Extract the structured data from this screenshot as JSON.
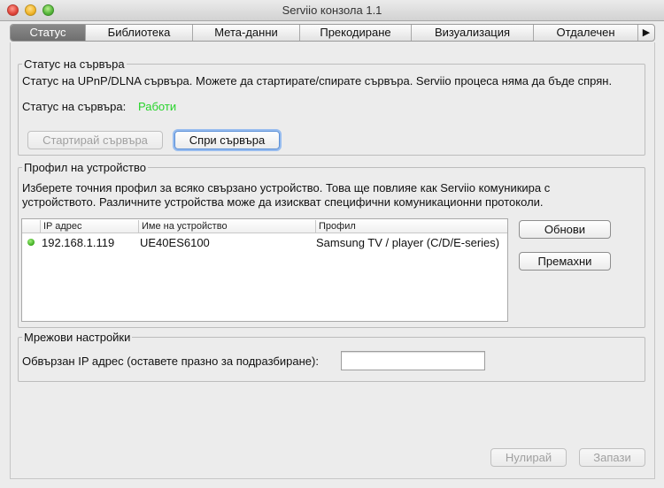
{
  "window": {
    "title": "Serviio конзола 1.1"
  },
  "tabs": [
    {
      "label": "Статус",
      "active": true
    },
    {
      "label": "Библиотека",
      "active": false
    },
    {
      "label": "Мета-данни",
      "active": false
    },
    {
      "label": "Прекодиране",
      "active": false
    },
    {
      "label": "Визуализация",
      "active": false
    },
    {
      "label": "Отдалечен",
      "active": false
    }
  ],
  "tabs_more_icon": "▶",
  "server_status": {
    "legend": "Статус на сървъра",
    "description": "Статус на UPnP/DLNA сървъра. Можете да стартирате/спирате сървъра. Serviio процеса няма да бъде спрян.",
    "status_label": "Статус на сървъра:",
    "status_value": "Работи",
    "status_color": "#27d42b",
    "start_button": "Стартирай сървъра",
    "stop_button": "Спри сървъра"
  },
  "device_profile": {
    "legend": "Профил на устройство",
    "description_line1": "Изберете точния профил за всяко свързано устройство. Това ще повлияе как Serviio комуникира с",
    "description_line2": "устройството. Различните устройства може да изискват специфични комуникационни протоколи.",
    "columns": [
      "IP адрес",
      "Име на устройство",
      "Профил"
    ],
    "rows": [
      {
        "ip": "192.168.1.119",
        "name": "UE40ES6100",
        "profile": "Samsung TV / player (C/D/E-series)",
        "online": true
      }
    ],
    "refresh_button": "Обнови",
    "remove_button": "Премахни"
  },
  "network": {
    "legend": "Мрежови настройки",
    "bound_ip_label": "Обвързан IP адрес (оставете празно за подразбиране):",
    "bound_ip_value": ""
  },
  "footer": {
    "reset_button": "Нулирай",
    "save_button": "Запази"
  }
}
